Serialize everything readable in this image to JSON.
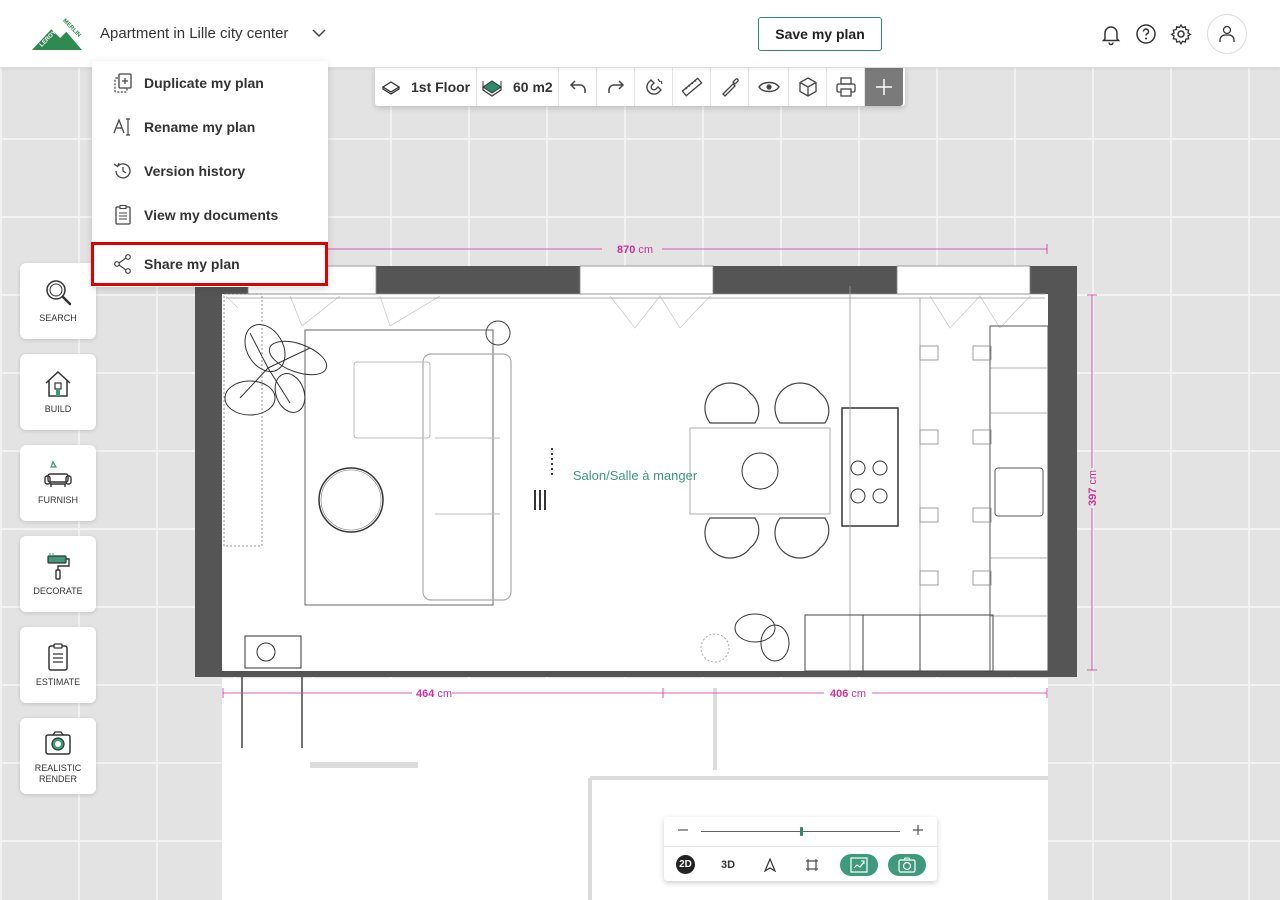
{
  "header": {
    "plan_title": "Apartment in Lille city center",
    "save_label": "Save my plan",
    "logo_text_top": "LEROY",
    "logo_text_bottom": "MERLIN"
  },
  "menu": {
    "items": [
      {
        "label": "Duplicate my plan",
        "icon": "duplicate-icon"
      },
      {
        "label": "Rename my plan",
        "icon": "rename-icon"
      },
      {
        "label": "Version history",
        "icon": "history-icon"
      },
      {
        "label": "View my documents",
        "icon": "documents-icon"
      },
      {
        "label": "Share my plan",
        "icon": "share-icon",
        "highlighted": true
      }
    ]
  },
  "toolbar": {
    "floor_label": "1st Floor",
    "area_label": "60 m2",
    "tools": [
      "undo-icon",
      "redo-icon",
      "magnet-icon",
      "ruler-icon",
      "eyedropper-icon",
      "eye-icon",
      "cube-icon",
      "print-icon",
      "plus-icon"
    ]
  },
  "sidebar": {
    "items": [
      {
        "label": "SEARCH",
        "icon": "search-icon"
      },
      {
        "label": "BUILD",
        "icon": "house-icon"
      },
      {
        "label": "FURNISH",
        "icon": "sofa-icon"
      },
      {
        "label": "DECORATE",
        "icon": "paint-roller-icon"
      },
      {
        "label": "ESTIMATE",
        "icon": "clipboard-icon"
      },
      {
        "label": "REALISTIC RENDER",
        "label_line1": "REALISTIC",
        "label_line2": "RENDER",
        "icon": "camera-icon"
      }
    ]
  },
  "plan": {
    "room_label": "Salon/Salle à manger",
    "dim_top": "870",
    "dim_bottom_left": "464",
    "dim_bottom_right": "406",
    "dim_right": "397",
    "unit": "cm"
  },
  "view_controls": {
    "zoom_level": 0.5,
    "btn_2d": "2D",
    "btn_3d": "3D"
  },
  "colors": {
    "brand_green": "#2e8b6a",
    "dimension_magenta": "#d0309a",
    "highlight_red": "#e00000",
    "room_label": "#3d9a7b"
  }
}
